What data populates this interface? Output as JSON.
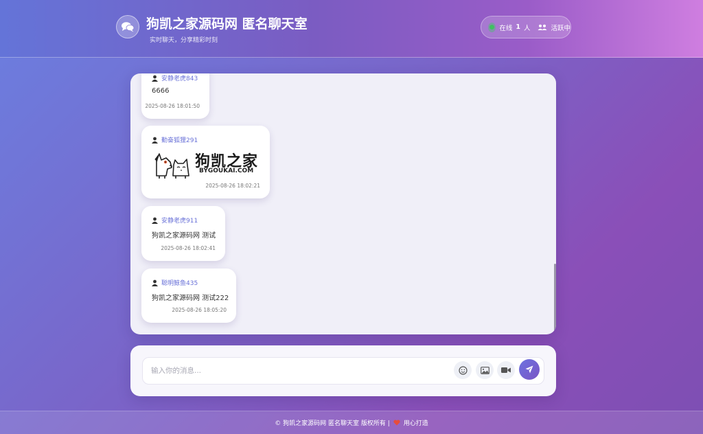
{
  "header": {
    "title": "狗凯之家源码网 匿名聊天室",
    "subtitle": "实时聊天，分享精彩时刻",
    "online_prefix": "在线",
    "online_count": "1",
    "online_suffix": "人",
    "active_label": "活跃中"
  },
  "messages": [
    {
      "user": "安静老虎843",
      "text": "6666",
      "time": "2025-08-26 18:01:50"
    },
    {
      "user": "勤奋狐狸291",
      "image": "狗凯之家 BYGOUKAI.COM logo image",
      "image_text": "狗凯之家",
      "image_subtext": "BYGOUKAI.COM",
      "time": "2025-08-26 18:02:21"
    },
    {
      "user": "安静老虎911",
      "text": "狗凯之家源码网 测试",
      "time": "2025-08-26 18:02:41"
    },
    {
      "user": "聪明鲸鱼435",
      "text": "狗凯之家源码网 测试222",
      "time": "2025-08-26 18:05:20"
    }
  ],
  "composer": {
    "placeholder": "输入你的消息...",
    "value": ""
  },
  "footer": {
    "copyright": "© 狗凯之家源码网 匿名聊天室 版权所有 |",
    "made_with": "用心打造"
  },
  "icons": [
    "chat-bubbles-icon",
    "online-dot-icon",
    "users-icon",
    "user-icon",
    "emoji-icon",
    "image-icon",
    "video-icon",
    "send-icon",
    "heart-icon"
  ],
  "colors": {
    "accent": "#6d72e0",
    "username": "#6a72d8",
    "online_dot": "#3fc061",
    "heart": "#e74c3c"
  }
}
